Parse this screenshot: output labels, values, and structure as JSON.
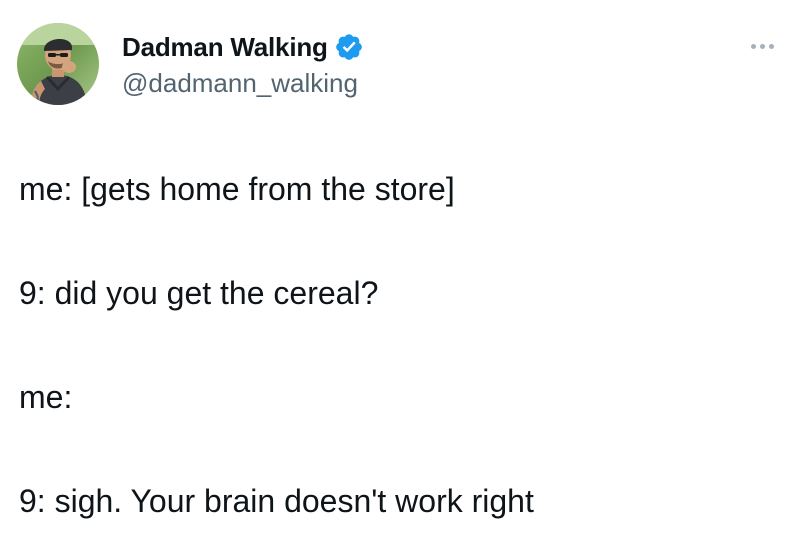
{
  "tweet": {
    "author": {
      "display_name": "Dadman Walking",
      "handle": "@dadmann_walking",
      "verified": true,
      "avatar_icon": "profile-photo"
    },
    "more_icon": "more-options-icon",
    "lines": [
      "me: [gets home from the store]",
      "9: did you get the cereal?",
      "me:",
      "9: sigh. Your brain doesn't work right"
    ]
  },
  "colors": {
    "text": "#0f1419",
    "secondary_text": "#536471",
    "verified_badge": "#1d9bf0",
    "more_dots": "#a7b1ba"
  }
}
